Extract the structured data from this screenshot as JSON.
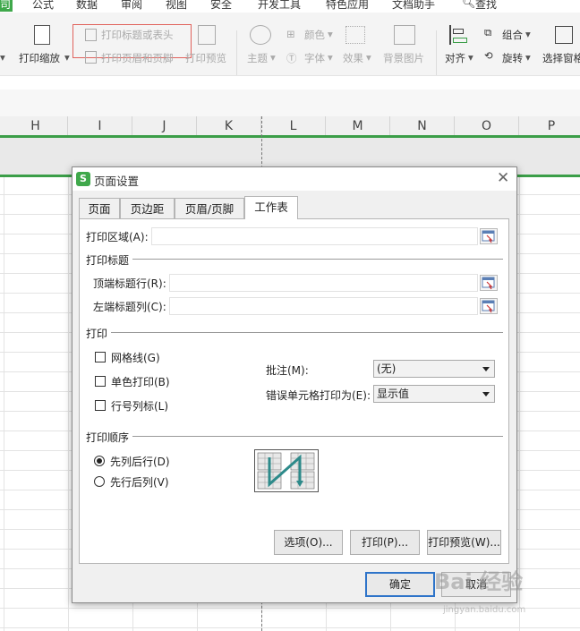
{
  "menubar": {
    "items": [
      "司",
      "公式",
      "数据",
      "审阅",
      "视图",
      "安全",
      "开发工具",
      "特色应用",
      "文档助手",
      "查找"
    ]
  },
  "ribbon": {
    "print_title": "打印标题或表头",
    "print_header_footer": "打印页眉和页脚",
    "print_scale": "打印缩放",
    "print_preview": "打印预览",
    "theme": "主题",
    "color": "颜色",
    "font": "字体",
    "effect": "效果",
    "background": "背景图片",
    "align": "对齐",
    "group": "组合",
    "rotate": "旋转",
    "selection_pane": "选择窗格"
  },
  "columns": [
    "H",
    "I",
    "J",
    "K",
    "L",
    "M",
    "N",
    "O",
    "P"
  ],
  "dialog": {
    "title": "页面设置",
    "tabs": [
      "页面",
      "页边距",
      "页眉/页脚",
      "工作表"
    ],
    "print_area_label": "打印区域(A):",
    "print_titles_section": "打印标题",
    "top_rows_label": "顶端标题行(R):",
    "left_cols_label": "左端标题列(C):",
    "print_section": "打印",
    "gridlines_label": "网格线(G)",
    "mono_label": "单色打印(B)",
    "rowcol_label": "行号列标(L)",
    "comments_label": "批注(M):",
    "comments_value": "(无)",
    "errors_label": "错误单元格打印为(E):",
    "errors_value": "显示值",
    "order_section": "打印顺序",
    "down_then_over": "先列后行(D)",
    "over_then_down": "先行后列(V)",
    "options_btn": "选项(O)...",
    "print_btn": "打印(P)...",
    "preview_btn": "打印预览(W)...",
    "ok_btn": "确定",
    "cancel_btn": "取消"
  },
  "watermark": {
    "main": "Bai 经验",
    "sub": "jingyan.baidu.com"
  }
}
